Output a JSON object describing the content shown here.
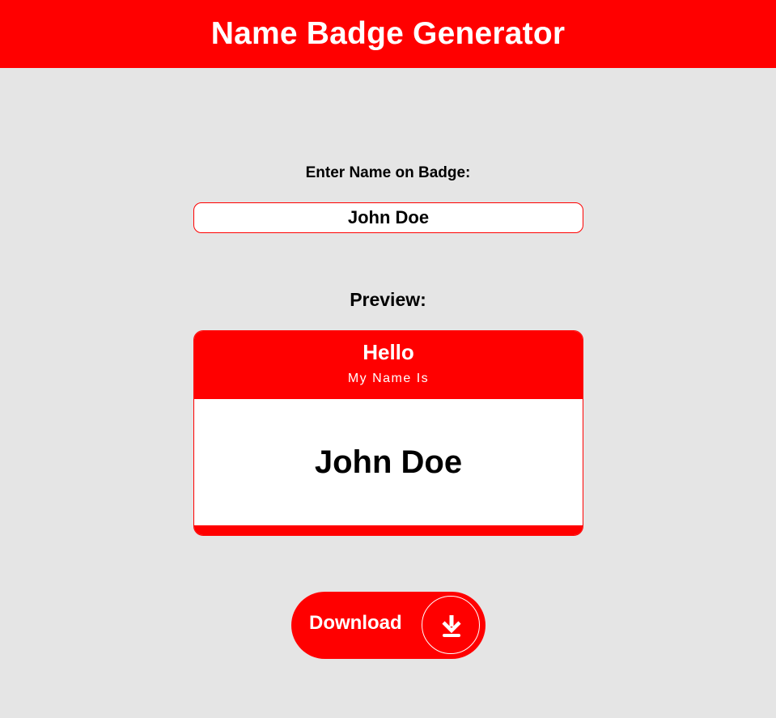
{
  "app": {
    "title": "Name Badge Generator"
  },
  "form": {
    "label": "Enter Name on Badge:",
    "input_value": "John Doe"
  },
  "preview": {
    "label": "Preview:",
    "badge": {
      "greeting": "Hello",
      "subtitle": "My Name Is",
      "name": "John Doe"
    }
  },
  "download": {
    "label": "Download",
    "icon": "download-arrow-icon"
  },
  "colors": {
    "accent": "#ff0000",
    "background": "#e5e5e5",
    "badge_body": "#ffffff",
    "text": "#000000"
  }
}
